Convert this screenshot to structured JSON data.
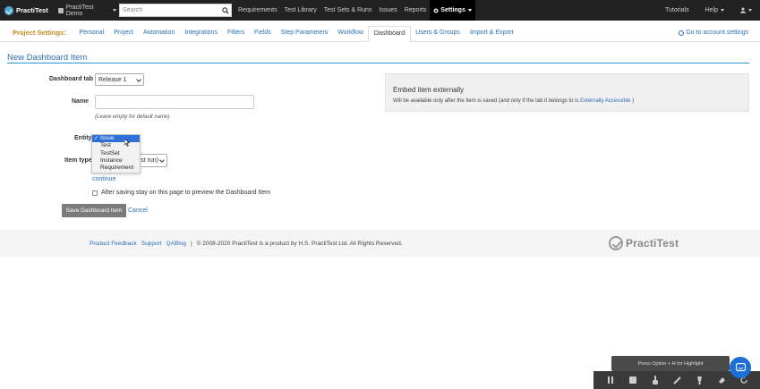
{
  "topnav": {
    "logo_text": "PractiTest",
    "project_name": "PractiTest Demo",
    "search_placeholder": "Search",
    "links": [
      "Requirements",
      "Test Library",
      "Test Sets & Runs",
      "Issues",
      "Reports"
    ],
    "settings_label": "Settings",
    "tutorials_label": "Tutorials",
    "help_label": "Help"
  },
  "subnav": {
    "title": "Project Settings:",
    "tabs": [
      "Personal",
      "Project",
      "Automation",
      "Integrations",
      "Filters",
      "Fields",
      "Step Parameters",
      "Workflow",
      "Dashboard",
      "Users & Groups",
      "Import & Export"
    ],
    "active_tab": "Dashboard",
    "back_link": "Go to account settings"
  },
  "page": {
    "title": "New Dashboard Item"
  },
  "form": {
    "dashboard_tab_label": "Dashboard tab",
    "dashboard_tab_value": "Release 1",
    "name_label": "Name",
    "name_value": "",
    "name_hint": "(Leave empty for default name)",
    "entity_label": "Entity",
    "entity_options": [
      "Issue",
      "Test",
      "TestSet",
      "Instance",
      "Requirement"
    ],
    "entity_selected": "Issue",
    "item_type_label": "Item type",
    "item_type_partial": "last run)",
    "continue_label": "continue",
    "stay_checkbox_label": "After saving stay on this page to preview the Dashboard Item",
    "save_label": "Save Dashboard Item",
    "cancel_label": "Cancel"
  },
  "embed": {
    "title": "Embed item externally",
    "desc_prefix": "Will be available only after the item is saved (and only if the tab it belongs to is",
    "desc_link": "Externally Accessible",
    "desc_suffix": ")"
  },
  "footer": {
    "links": [
      "Product Feedback",
      "Support",
      "QABlog"
    ],
    "separator": "|",
    "copyright": "© 2008-2020  PractiTest is a product by H.S. PractiTest Ltd. All Rights Reserved.",
    "logo_text": "PractiTest"
  },
  "recorder": {
    "tip": "Press Option + H for Highlight"
  },
  "colors": {
    "topbar": "#222222",
    "accent_blue": "#2a6fb0",
    "settings_title": "#c5891e",
    "save_button": "#7b7b7b",
    "chat": "#1c6fd6"
  }
}
